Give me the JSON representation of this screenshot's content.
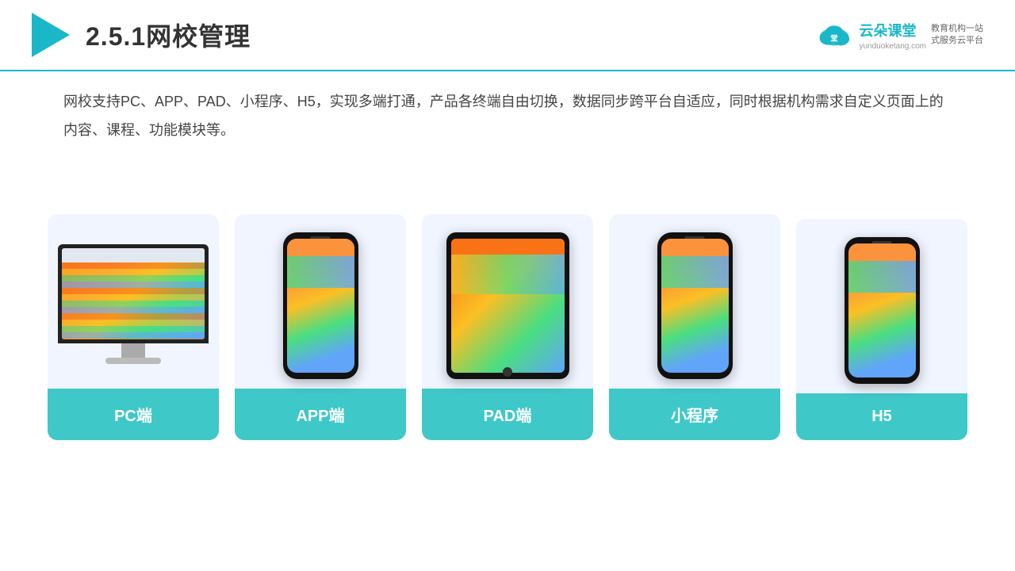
{
  "header": {
    "title": "2.5.1网校管理",
    "brand_cn": "云朵课堂",
    "brand_en": "yunduoketang.com",
    "brand_tagline": "教育机构一站\n式服务云平台"
  },
  "description": "网校支持PC、APP、PAD、小程序、H5，实现多端打通，产品各终端自由切换，数据同步跨平台自适应，同时根据机构需求自定义页面上的内容、课程、功能模块等。",
  "cards": [
    {
      "id": "pc",
      "label": "PC端"
    },
    {
      "id": "app",
      "label": "APP端"
    },
    {
      "id": "pad",
      "label": "PAD端"
    },
    {
      "id": "mini",
      "label": "小程序"
    },
    {
      "id": "h5",
      "label": "H5"
    }
  ],
  "accent_color": "#3ec8c8"
}
